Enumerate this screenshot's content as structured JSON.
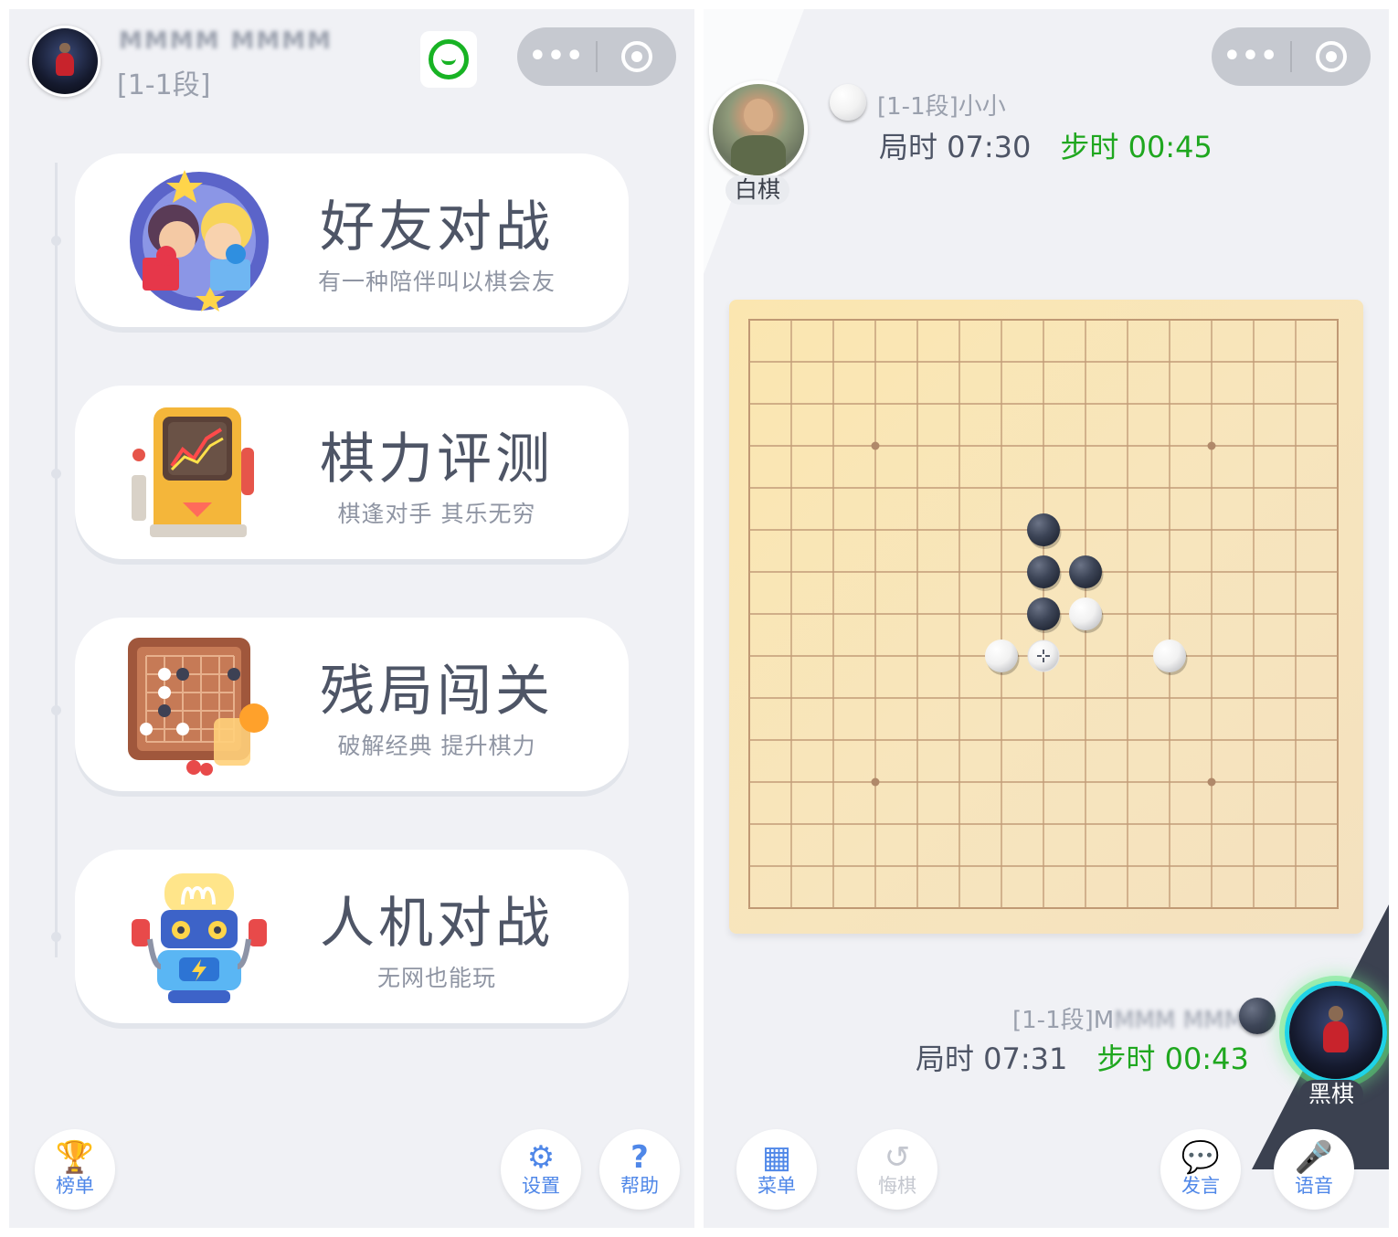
{
  "lobby": {
    "user": {
      "name": "MMMM MMMM",
      "rank": "[1-1段]"
    },
    "capsule": {
      "more": "•••"
    },
    "menu": [
      {
        "title": "好友对战",
        "subtitle": "有一种陪伴叫以棋会友",
        "icon": "friends-battle-icon"
      },
      {
        "title": "棋力评测",
        "subtitle": "棋逢对手 其乐无穷",
        "icon": "rating-machine-icon"
      },
      {
        "title": "残局闯关",
        "subtitle": "破解经典 提升棋力",
        "icon": "endgame-board-icon"
      },
      {
        "title": "人机对战",
        "subtitle": "无网也能玩",
        "icon": "robot-icon"
      }
    ],
    "bottom": {
      "rank_label": "榜单",
      "settings_label": "设置",
      "help_label": "帮助"
    }
  },
  "game": {
    "capsule": {
      "more": "•••"
    },
    "white": {
      "label": "白棋",
      "name_prefix": "[1-1段]小小",
      "round_time": "局时 07:30",
      "step_time": "步时 00:45"
    },
    "black": {
      "label": "黑棋",
      "name_prefix": "[1-1段]M",
      "name_blurred": "MMM MMM",
      "name_suffix": "...",
      "round_time": "局时 07:31",
      "step_time": "步时 00:43"
    },
    "board": {
      "size": 15,
      "star_points": [
        [
          3,
          3
        ],
        [
          3,
          11
        ],
        [
          11,
          3
        ],
        [
          11,
          11
        ]
      ],
      "black_stones": [
        [
          7,
          5
        ],
        [
          7,
          6
        ],
        [
          8,
          6
        ],
        [
          7,
          7
        ]
      ],
      "white_stones": [
        [
          8,
          7
        ],
        [
          6,
          8
        ],
        [
          10,
          8
        ]
      ],
      "cursor": [
        7,
        8
      ]
    },
    "bottom": {
      "menu_label": "菜单",
      "undo_label": "悔棋",
      "chat_label": "发言",
      "voice_label": "语音"
    }
  },
  "colors": {
    "accent": "#4f87e8",
    "step_time": "#1fa71f",
    "wechat_green": "#18b324",
    "board": "#f7e5bd"
  }
}
